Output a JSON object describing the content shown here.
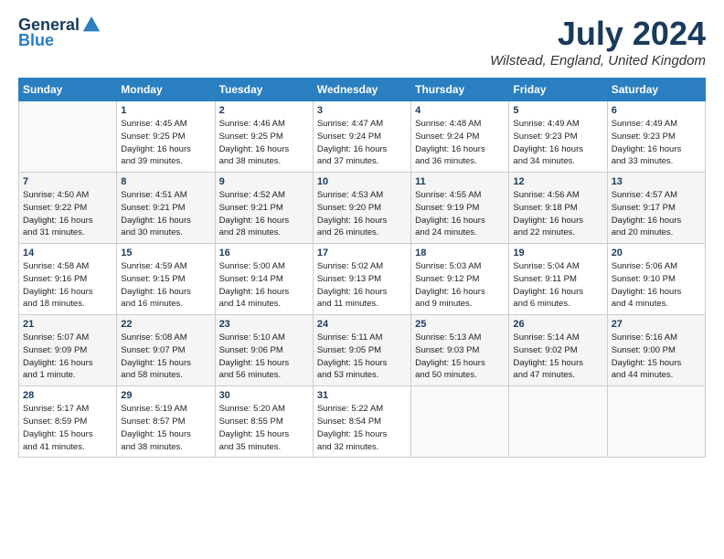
{
  "header": {
    "logo_general": "General",
    "logo_blue": "Blue",
    "title": "July 2024",
    "subtitle": "Wilstead, England, United Kingdom"
  },
  "columns": [
    "Sunday",
    "Monday",
    "Tuesday",
    "Wednesday",
    "Thursday",
    "Friday",
    "Saturday"
  ],
  "weeks": [
    [
      {
        "day": "",
        "info": ""
      },
      {
        "day": "1",
        "info": "Sunrise: 4:45 AM\nSunset: 9:25 PM\nDaylight: 16 hours\nand 39 minutes."
      },
      {
        "day": "2",
        "info": "Sunrise: 4:46 AM\nSunset: 9:25 PM\nDaylight: 16 hours\nand 38 minutes."
      },
      {
        "day": "3",
        "info": "Sunrise: 4:47 AM\nSunset: 9:24 PM\nDaylight: 16 hours\nand 37 minutes."
      },
      {
        "day": "4",
        "info": "Sunrise: 4:48 AM\nSunset: 9:24 PM\nDaylight: 16 hours\nand 36 minutes."
      },
      {
        "day": "5",
        "info": "Sunrise: 4:49 AM\nSunset: 9:23 PM\nDaylight: 16 hours\nand 34 minutes."
      },
      {
        "day": "6",
        "info": "Sunrise: 4:49 AM\nSunset: 9:23 PM\nDaylight: 16 hours\nand 33 minutes."
      }
    ],
    [
      {
        "day": "7",
        "info": "Sunrise: 4:50 AM\nSunset: 9:22 PM\nDaylight: 16 hours\nand 31 minutes."
      },
      {
        "day": "8",
        "info": "Sunrise: 4:51 AM\nSunset: 9:21 PM\nDaylight: 16 hours\nand 30 minutes."
      },
      {
        "day": "9",
        "info": "Sunrise: 4:52 AM\nSunset: 9:21 PM\nDaylight: 16 hours\nand 28 minutes."
      },
      {
        "day": "10",
        "info": "Sunrise: 4:53 AM\nSunset: 9:20 PM\nDaylight: 16 hours\nand 26 minutes."
      },
      {
        "day": "11",
        "info": "Sunrise: 4:55 AM\nSunset: 9:19 PM\nDaylight: 16 hours\nand 24 minutes."
      },
      {
        "day": "12",
        "info": "Sunrise: 4:56 AM\nSunset: 9:18 PM\nDaylight: 16 hours\nand 22 minutes."
      },
      {
        "day": "13",
        "info": "Sunrise: 4:57 AM\nSunset: 9:17 PM\nDaylight: 16 hours\nand 20 minutes."
      }
    ],
    [
      {
        "day": "14",
        "info": "Sunrise: 4:58 AM\nSunset: 9:16 PM\nDaylight: 16 hours\nand 18 minutes."
      },
      {
        "day": "15",
        "info": "Sunrise: 4:59 AM\nSunset: 9:15 PM\nDaylight: 16 hours\nand 16 minutes."
      },
      {
        "day": "16",
        "info": "Sunrise: 5:00 AM\nSunset: 9:14 PM\nDaylight: 16 hours\nand 14 minutes."
      },
      {
        "day": "17",
        "info": "Sunrise: 5:02 AM\nSunset: 9:13 PM\nDaylight: 16 hours\nand 11 minutes."
      },
      {
        "day": "18",
        "info": "Sunrise: 5:03 AM\nSunset: 9:12 PM\nDaylight: 16 hours\nand 9 minutes."
      },
      {
        "day": "19",
        "info": "Sunrise: 5:04 AM\nSunset: 9:11 PM\nDaylight: 16 hours\nand 6 minutes."
      },
      {
        "day": "20",
        "info": "Sunrise: 5:06 AM\nSunset: 9:10 PM\nDaylight: 16 hours\nand 4 minutes."
      }
    ],
    [
      {
        "day": "21",
        "info": "Sunrise: 5:07 AM\nSunset: 9:09 PM\nDaylight: 16 hours\nand 1 minute."
      },
      {
        "day": "22",
        "info": "Sunrise: 5:08 AM\nSunset: 9:07 PM\nDaylight: 15 hours\nand 58 minutes."
      },
      {
        "day": "23",
        "info": "Sunrise: 5:10 AM\nSunset: 9:06 PM\nDaylight: 15 hours\nand 56 minutes."
      },
      {
        "day": "24",
        "info": "Sunrise: 5:11 AM\nSunset: 9:05 PM\nDaylight: 15 hours\nand 53 minutes."
      },
      {
        "day": "25",
        "info": "Sunrise: 5:13 AM\nSunset: 9:03 PM\nDaylight: 15 hours\nand 50 minutes."
      },
      {
        "day": "26",
        "info": "Sunrise: 5:14 AM\nSunset: 9:02 PM\nDaylight: 15 hours\nand 47 minutes."
      },
      {
        "day": "27",
        "info": "Sunrise: 5:16 AM\nSunset: 9:00 PM\nDaylight: 15 hours\nand 44 minutes."
      }
    ],
    [
      {
        "day": "28",
        "info": "Sunrise: 5:17 AM\nSunset: 8:59 PM\nDaylight: 15 hours\nand 41 minutes."
      },
      {
        "day": "29",
        "info": "Sunrise: 5:19 AM\nSunset: 8:57 PM\nDaylight: 15 hours\nand 38 minutes."
      },
      {
        "day": "30",
        "info": "Sunrise: 5:20 AM\nSunset: 8:55 PM\nDaylight: 15 hours\nand 35 minutes."
      },
      {
        "day": "31",
        "info": "Sunrise: 5:22 AM\nSunset: 8:54 PM\nDaylight: 15 hours\nand 32 minutes."
      },
      {
        "day": "",
        "info": ""
      },
      {
        "day": "",
        "info": ""
      },
      {
        "day": "",
        "info": ""
      }
    ]
  ]
}
